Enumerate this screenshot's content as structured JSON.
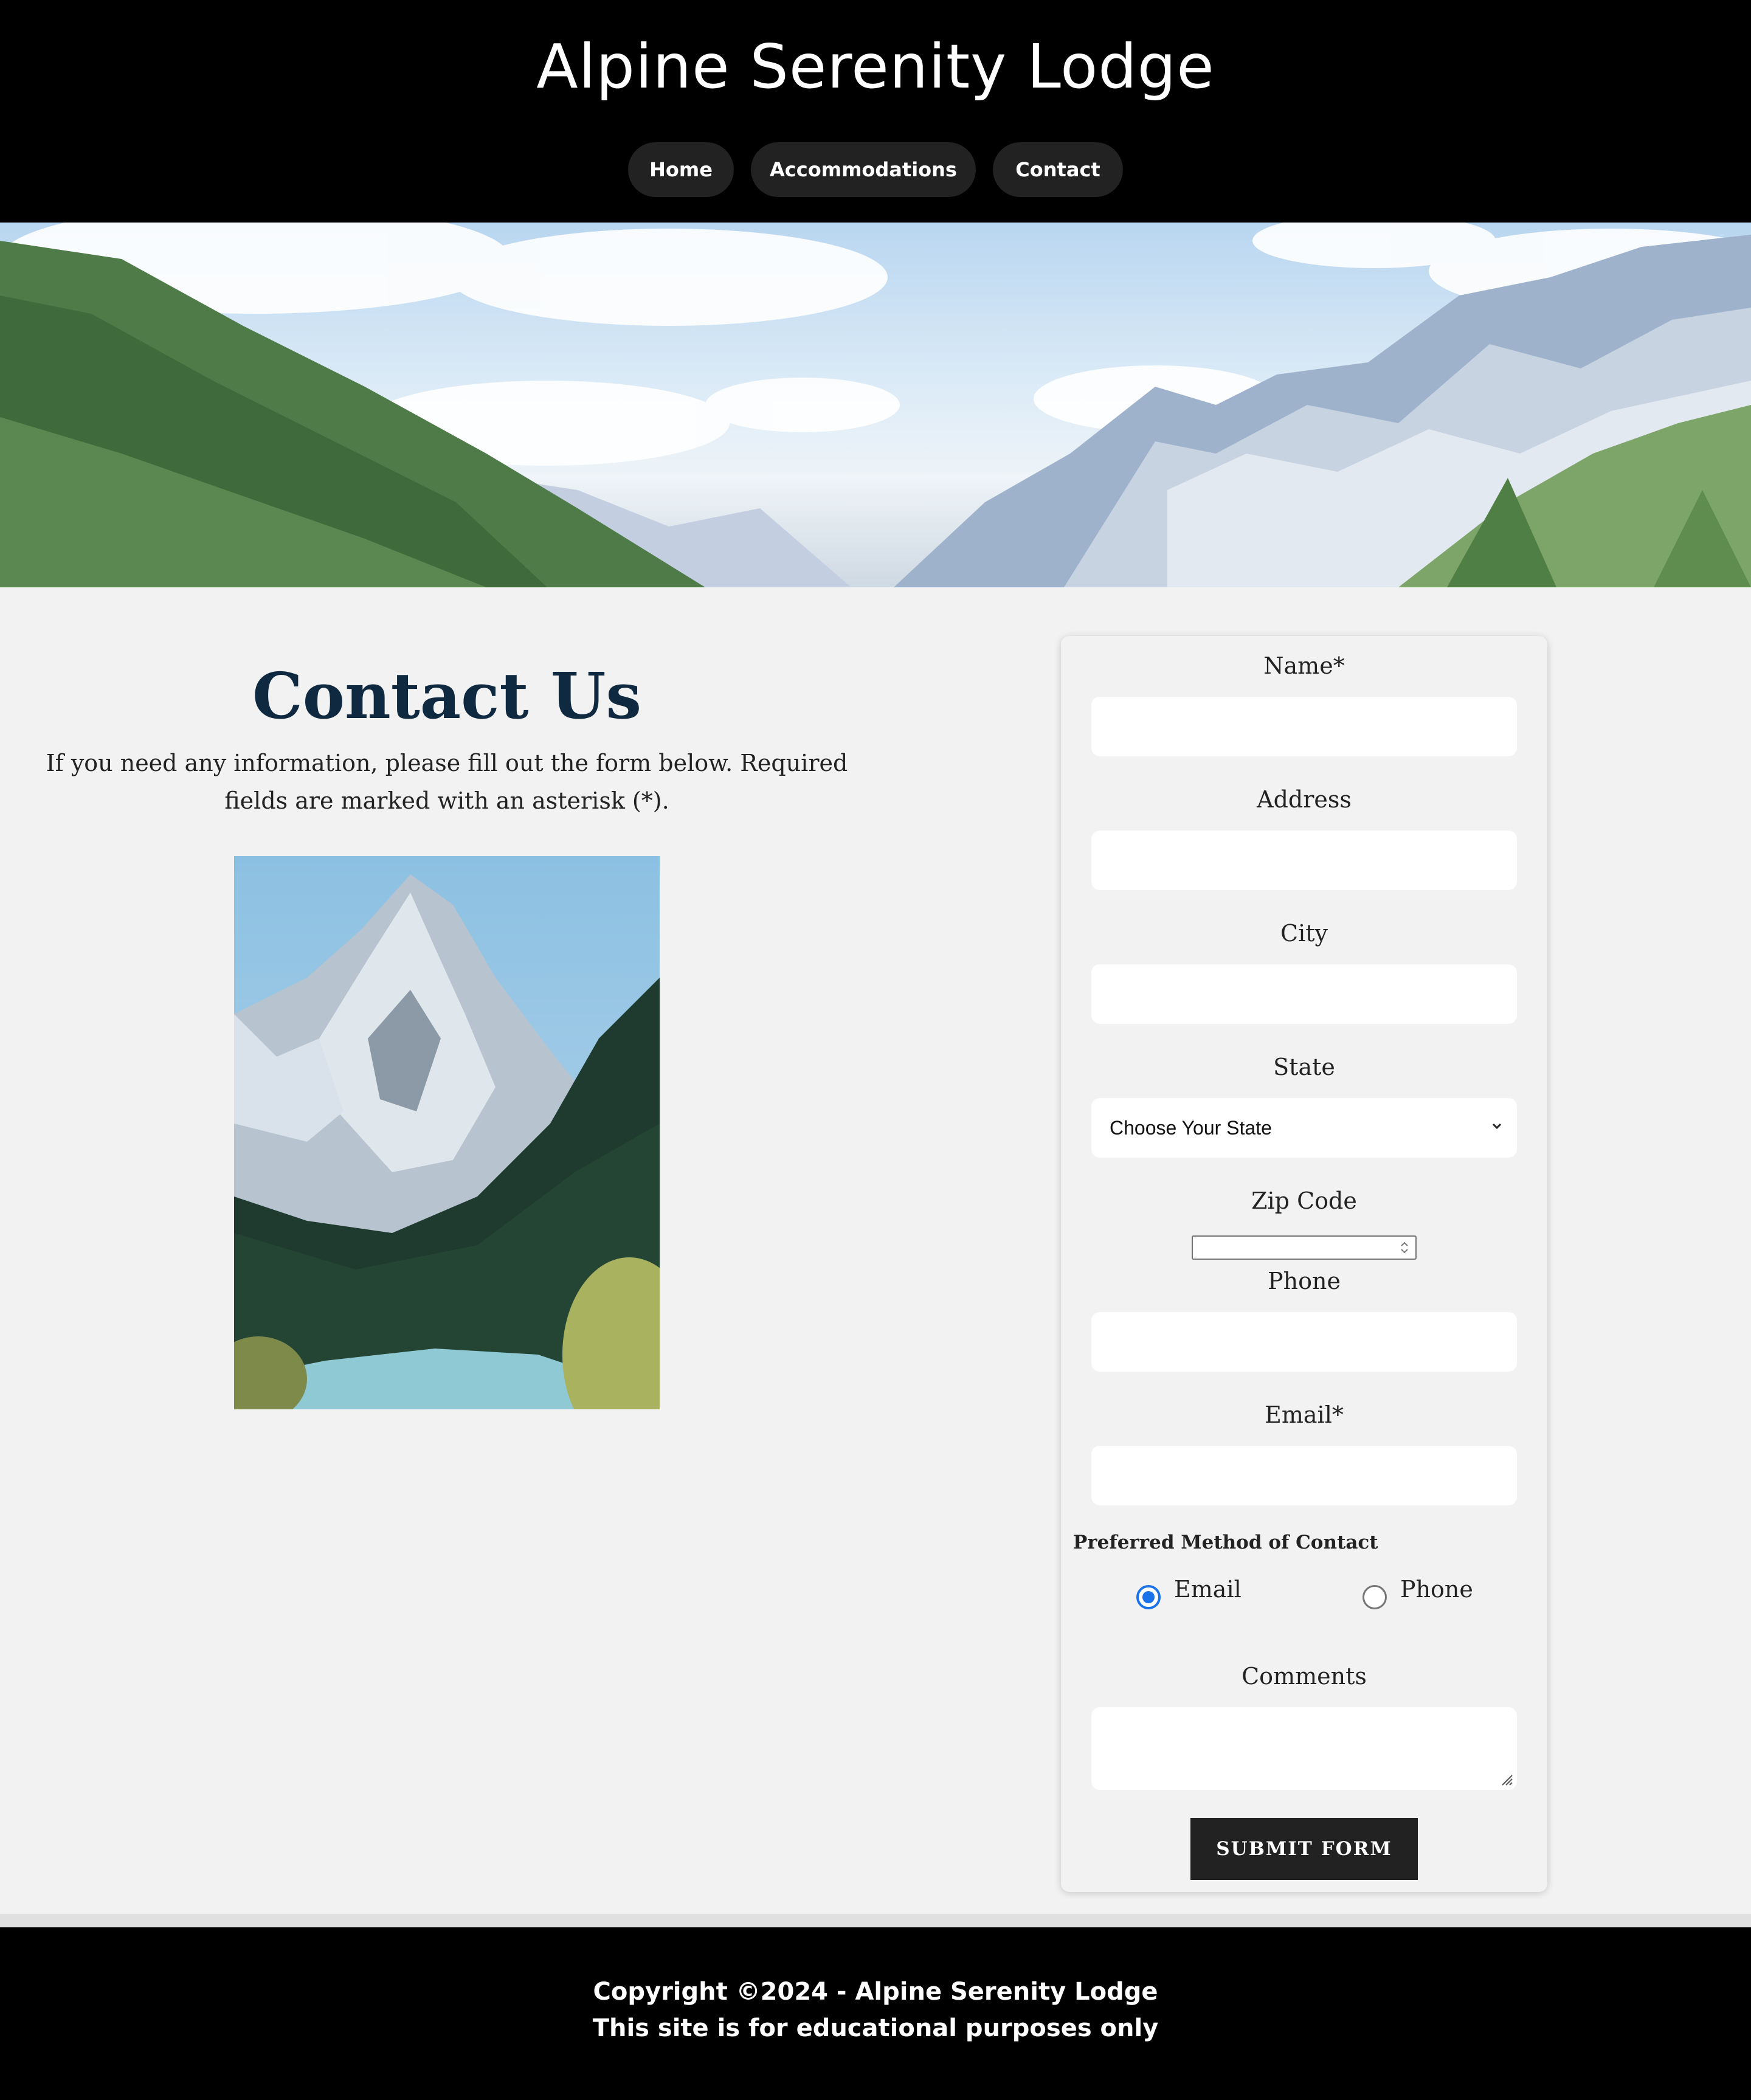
{
  "header": {
    "title": "Alpine Serenity Lodge",
    "nav": [
      {
        "label": "Home"
      },
      {
        "label": "Accommodations"
      },
      {
        "label": "Contact"
      }
    ]
  },
  "main": {
    "heading": "Contact Us",
    "intro": "If you need any information, please fill out the form below. Required fields are marked with an asterisk (*)."
  },
  "form": {
    "name_label": "Name*",
    "address_label": "Address",
    "city_label": "City",
    "state_label": "State",
    "state_selected": "Choose Your State",
    "zip_label": "Zip Code",
    "phone_label": "Phone",
    "email_label": "Email*",
    "preferred_label": "Preferred Method of Contact",
    "radio_email": "Email",
    "radio_phone": "Phone",
    "preferred_selected": "Email",
    "comments_label": "Comments",
    "submit_label": "SUBMIT FORM"
  },
  "footer": {
    "copyright": "Copyright ©2024 - Alpine Serenity Lodge",
    "note": "This site is for educational purposes only"
  },
  "colors": {
    "header_bg": "#000000",
    "nav_button_bg": "#222222",
    "heading_color": "#0f2a40",
    "page_bg": "#f2f2f2",
    "radio_accent": "#1a73e8"
  }
}
